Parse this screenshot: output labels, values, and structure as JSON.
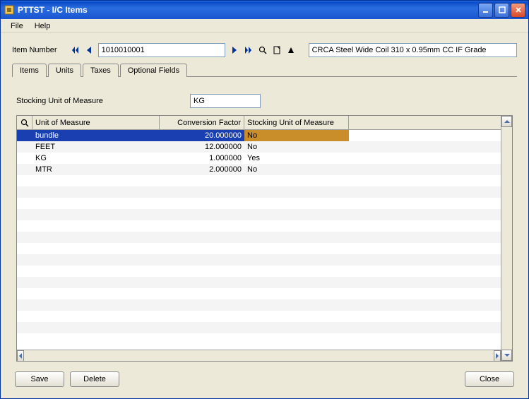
{
  "window": {
    "title": "PTTST - I/C Items"
  },
  "menu": {
    "file": "File",
    "help": "Help"
  },
  "top": {
    "item_number_label": "Item Number",
    "item_number_value": "1010010001",
    "item_description": "CRCA Steel Wide Coil 310 x 0.95mm CC IF Grade"
  },
  "tabs": {
    "items": "Items",
    "units": "Units",
    "taxes": "Taxes",
    "optional": "Optional Fields",
    "active": 1
  },
  "units": {
    "sum_label": "Stocking Unit of Measure",
    "sum_value": "KG",
    "columns": {
      "uom": "Unit of Measure",
      "conv": "Conversion Factor",
      "sum": "Stocking Unit of Measure"
    },
    "rows": [
      {
        "uom": "bundle",
        "conv": "20.000000",
        "sum": "No",
        "selected": true
      },
      {
        "uom": "FEET",
        "conv": "12.000000",
        "sum": "No",
        "selected": false
      },
      {
        "uom": "KG",
        "conv": "1.000000",
        "sum": "Yes",
        "selected": false
      },
      {
        "uom": "MTR",
        "conv": "2.000000",
        "sum": "No",
        "selected": false
      }
    ]
  },
  "buttons": {
    "save": "Save",
    "delete": "Delete",
    "close": "Close"
  }
}
